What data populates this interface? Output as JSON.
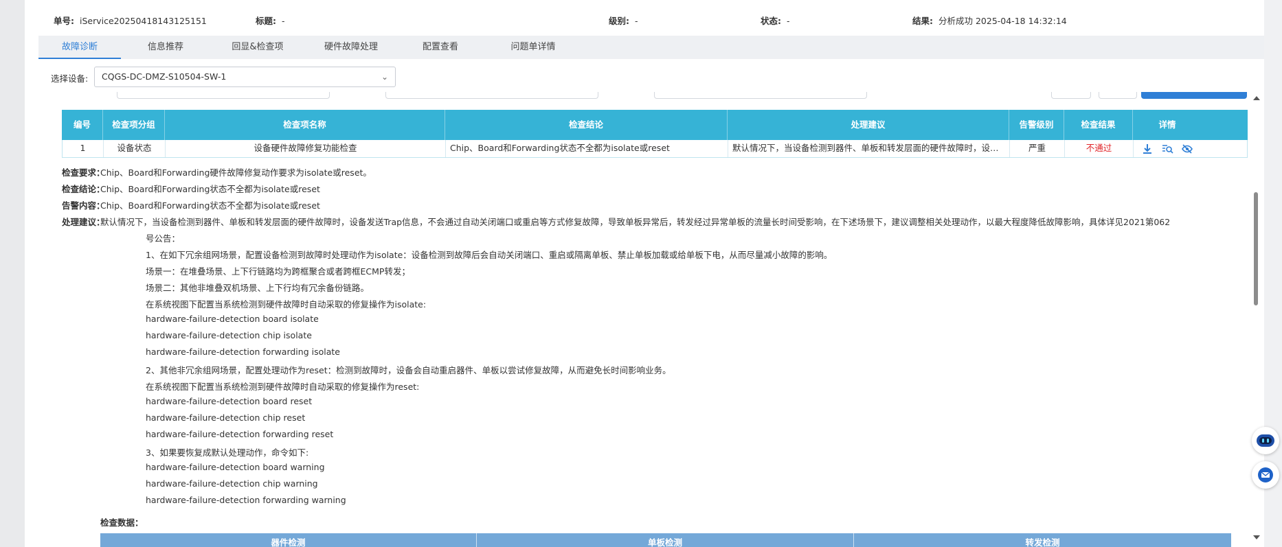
{
  "header": {
    "ticket_label": "单号:",
    "ticket_value": "iService20250418143125151",
    "title_label": "标题:",
    "title_value": "-",
    "level_label": "级别:",
    "level_value": "-",
    "status_label": "状态:",
    "status_value": "-",
    "result_label": "结果:",
    "result_value": "分析成功 2025-04-18 14:32:14"
  },
  "tabs": [
    {
      "label": "故障诊断",
      "active": true
    },
    {
      "label": "信息推荐"
    },
    {
      "label": "回显&检查项"
    },
    {
      "label": "硬件故障处理"
    },
    {
      "label": "配置查看"
    },
    {
      "label": "问题单详情"
    }
  ],
  "device": {
    "label": "选择设备:",
    "selected": "CQGS-DC-DMZ-S10504-SW-1"
  },
  "table": {
    "headers": [
      "编号",
      "检查项分组",
      "检查项名称",
      "检查结论",
      "处理建议",
      "告警级别",
      "检查结果",
      "详情"
    ],
    "row": {
      "id": "1",
      "group": "设备状态",
      "name": "设备硬件故障修复功能检查",
      "conclusion": "Chip、Board和Forwarding状态不全都为isolate或reset",
      "suggestion": "默认情况下，当设备检测到器件、单板和转发层面的硬件故障时，设备发送Trap信息，不会通过自动关闭端口或重启等方式修复故障",
      "severity": "严重",
      "result": "不通过"
    }
  },
  "detail": {
    "req_label": "检查要求：",
    "req_value": "Chip、Board和Forwarding硬件故障修复动作要求为isolate或reset。",
    "conc_label": "检查结论：",
    "conc_value": "Chip、Board和Forwarding状态不全都为isolate或reset",
    "alarm_label": "告警内容：",
    "alarm_value": "Chip、Board和Forwarding状态不全都为isolate或reset",
    "sugg_label": "处理建议：",
    "sugg_lines": [
      "默认情况下，当设备检测到器件、单板和转发层面的硬件故障时，设备发送Trap信息，不会通过自动关闭端口或重启等方式修复故障，导致单板异常后，转发经过异常单板的流量长时间受影响，在下述场景下，建议调整相关处理动作，以最大程度降低故障影响，具体详见2021第062",
      "号公告：",
      "1、在如下冗余组网场景，配置设备检测到故障时处理动作为isolate：设备检测到故障后会自动关闭端口、重启或隔离单板、禁止单板加载或给单板下电，从而尽量减小故障的影响。",
      "场景一：在堆叠场景、上下行链路均为跨框聚合或者跨框ECMP转发；",
      "场景二：其他非堆叠双机场景、上下行均有冗余备份链路。",
      "在系统视图下配置当系统检测到硬件故障时自动采取的修复操作为isolate:",
      "hardware-failure-detection board isolate",
      "hardware-failure-detection chip isolate",
      "hardware-failure-detection forwarding isolate",
      "2、其他非冗余组网场景，配置处理动作为reset：检测到故障时，设备会自动重启器件、单板以尝试修复故障，从而避免长时间影响业务。",
      "在系统视图下配置当系统检测到硬件故障时自动采取的修复操作为reset:",
      "hardware-failure-detection board reset",
      "hardware-failure-detection chip reset",
      "hardware-failure-detection forwarding reset",
      "3、如果要恢复成默认处理动作，命令如下:",
      "hardware-failure-detection board warning",
      "hardware-failure-detection chip warning",
      "hardware-failure-detection forwarding warning"
    ],
    "data_label": "检查数据：",
    "sub_headers": [
      "器件检测",
      "单板检测",
      "转发检测"
    ]
  },
  "colors": {
    "table_header": "#36b3d6",
    "sub_header": "#74a8d8",
    "active_tab": "#2f7fd6",
    "fail": "#e0262a"
  }
}
